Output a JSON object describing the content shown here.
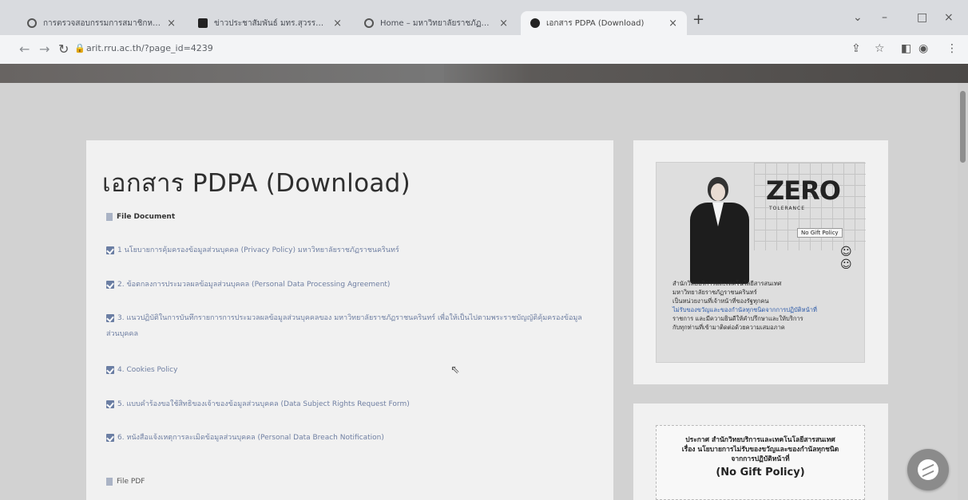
{
  "browser": {
    "tabs": [
      {
        "title": "การตรวจสอบกรรมการสมาชิกหน่วย",
        "active": false
      },
      {
        "title": "ข่าวประชาสัมพันธ์ มทร.สุวรรณภูมิ",
        "active": false
      },
      {
        "title": "Home – มหาวิทยาลัยราชภัฏราชนครินทร์",
        "active": false
      },
      {
        "title": "เอกสาร PDPA (Download)",
        "active": true
      }
    ],
    "url": "arit.rru.ac.th/?page_id=4239"
  },
  "main": {
    "title": "เอกสาร PDPA (Download)",
    "section_document": "File Document",
    "items": [
      "1 นโยบายการคุ้มครองข้อมูลส่วนบุคคล (Privacy Policy) มหาวิทยาลัยราชภัฏราชนครินทร์",
      "2. ข้อตกลงการประมวลผลข้อมูลส่วนบุคคล (Personal Data Processing Agreement)",
      "3. แนวปฏิบัติในการบันทึกรายการการประมวลผลข้อมูลส่วนบุคคลของ มหาวิทยาลัยราชภัฏราชนครินทร์ เพื่อให้เป็นไปตามพระราชบัญญัติคุ้มครองข้อมูลส่วนบุคคล",
      "4. Cookies Policy",
      "5. แบบคำร้องขอใช้สิทธิของเจ้าของข้อมูลส่วนบุคคล (Data Subject Rights Request Form)",
      "6. หนังสือแจ้งเหตุการละเมิดข้อมูลส่วนบุคคล (Personal Data Breach Notification)"
    ],
    "section_pdf": "File PDF"
  },
  "sidebar": {
    "poster1": {
      "zero": "ZERO",
      "zero_sub": "TOLERANCE",
      "tag": "No Gift Policy",
      "lines": [
        "สำนักวิทยบริการและเทคโนโลยีสารสนเทศ",
        "มหาวิทยาลัยราชภัฏราชนครินทร์",
        "เป็นหน่วยงานที่เจ้าหน้าที่ของรัฐทุกคน",
        "ไม่รับของขวัญและของกำนัลทุกชนิดจากการปฏิบัติหน้าที่",
        "ราชการ และมีความยินดีให้คำปรึกษาและให้บริการ",
        "กับทุกท่านที่เข้ามาติดต่อด้วยความเสมอภาค"
      ]
    },
    "poster2": {
      "line1": "ประกาศ สำนักวิทยบริการและเทคโนโลยีสารสนเทศ",
      "line2": "เรื่อง นโยบายการไม่รับของขวัญและของกำนัลทุกชนิด",
      "line3": "จากการปฏิบัติหน้าที่",
      "line4": "(No Gift Policy)"
    }
  }
}
